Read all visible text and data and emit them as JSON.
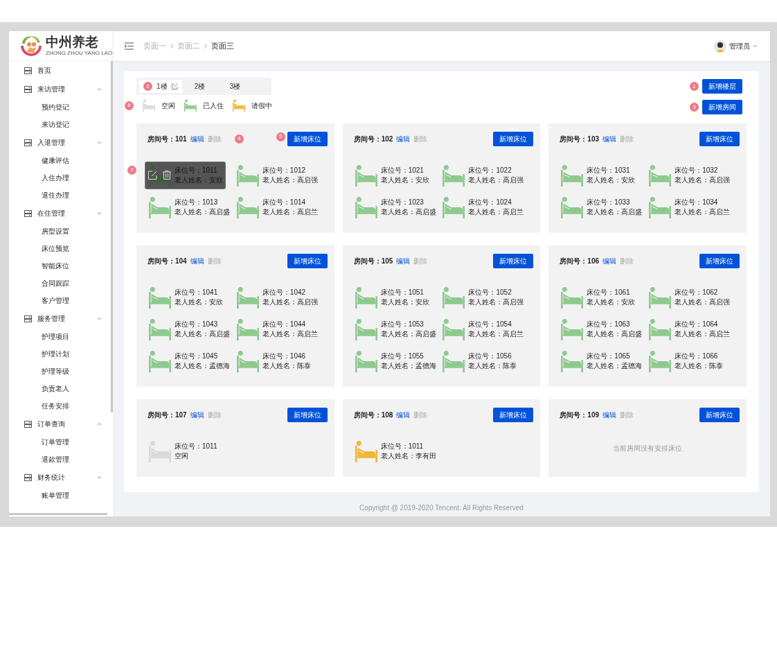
{
  "logo": {
    "title": "中州养老",
    "subtitle": "ZHONG ZHOU YANG LAO"
  },
  "sidebar": {
    "items": [
      {
        "label": "首页"
      },
      {
        "label": "来访管理",
        "expanded": true,
        "children": [
          {
            "label": "预约登记"
          },
          {
            "label": "来访登记"
          }
        ]
      },
      {
        "label": "入退管理",
        "expanded": true,
        "children": [
          {
            "label": "健康评估"
          },
          {
            "label": "入住办理"
          },
          {
            "label": "退住办理"
          }
        ]
      },
      {
        "label": "在住管理",
        "expanded": true,
        "children": [
          {
            "label": "房型设置"
          },
          {
            "label": "床位预览"
          },
          {
            "label": "智能床位"
          },
          {
            "label": "合同跟踪"
          },
          {
            "label": "客户管理"
          }
        ]
      },
      {
        "label": "服务管理",
        "expanded": true,
        "children": [
          {
            "label": "护理项目"
          },
          {
            "label": "护理计划"
          },
          {
            "label": "护理等级"
          },
          {
            "label": "负责老人"
          },
          {
            "label": "任务安排"
          }
        ]
      },
      {
        "label": "订单查询",
        "expanded": true,
        "children": [
          {
            "label": "订单管理"
          },
          {
            "label": "退款管理"
          }
        ]
      },
      {
        "label": "财务统计",
        "expanded": true,
        "children": [
          {
            "label": "账单管理"
          }
        ]
      }
    ]
  },
  "breadcrumb": [
    {
      "label": "页面一",
      "current": false
    },
    {
      "label": "页面二",
      "current": false
    },
    {
      "label": "页面三",
      "current": true
    }
  ],
  "user": {
    "name": "管理员"
  },
  "floor_tabs": [
    {
      "label": "1楼",
      "selected": true,
      "badge": "2"
    },
    {
      "label": "2楼",
      "selected": false
    },
    {
      "label": "3楼",
      "selected": false
    }
  ],
  "legend": {
    "badge": "8",
    "items": [
      {
        "label": "空闲",
        "kind": "free"
      },
      {
        "label": "已入住",
        "kind": "occupied"
      },
      {
        "label": "请假中",
        "kind": "leave"
      }
    ]
  },
  "actions": [
    {
      "label": "新增楼层",
      "badge": "1"
    },
    {
      "label": "新增房间",
      "badge": "3"
    }
  ],
  "rooms": [
    {
      "title": "房间号：101",
      "edit": "编辑",
      "delete": "删除",
      "delete_disabled": true,
      "badge": "4",
      "add_bed": "新增床位",
      "add_bed_badge": "5",
      "hover_badge": "7",
      "beds": [
        {
          "number": "床位号：1011",
          "person": "老人姓名：安欣",
          "kind": "occupied",
          "hovered": true
        },
        {
          "number": "床位号：1012",
          "person": "老人姓名：高启强",
          "kind": "occupied",
          "hovered": false
        },
        {
          "number": "床位号：1013",
          "person": "老人姓名：高启盛",
          "kind": "occupied",
          "hovered": false
        },
        {
          "number": "床位号：1014",
          "person": "老人姓名：高启兰",
          "kind": "occupied",
          "hovered": false
        }
      ]
    },
    {
      "title": "房间号：102",
      "edit": "编辑",
      "delete": "删除",
      "delete_disabled": true,
      "add_bed": "新增床位",
      "beds": [
        {
          "number": "床位号：1021",
          "person": "老人姓名：安欣",
          "kind": "occupied",
          "hovered": false
        },
        {
          "number": "床位号：1022",
          "person": "老人姓名：高启强",
          "kind": "occupied",
          "hovered": false
        },
        {
          "number": "床位号：1023",
          "person": "老人姓名：高启盛",
          "kind": "occupied",
          "hovered": false
        },
        {
          "number": "床位号：1024",
          "person": "老人姓名：高启兰",
          "kind": "occupied",
          "hovered": false
        }
      ]
    },
    {
      "title": "房间号：103",
      "edit": "编辑",
      "delete": "删除",
      "delete_disabled": true,
      "add_bed": "新增床位",
      "beds": [
        {
          "number": "床位号：1031",
          "person": "老人姓名：安欣",
          "kind": "occupied",
          "hovered": false
        },
        {
          "number": "床位号：1032",
          "person": "老人姓名：高启强",
          "kind": "occupied",
          "hovered": false
        },
        {
          "number": "床位号：1033",
          "person": "老人姓名：高启盛",
          "kind": "occupied",
          "hovered": false
        },
        {
          "number": "床位号：1034",
          "person": "老人姓名：高启兰",
          "kind": "occupied",
          "hovered": false
        }
      ]
    },
    {
      "title": "房间号：104",
      "edit": "编辑",
      "delete": "删除",
      "delete_disabled": true,
      "add_bed": "新增床位",
      "beds": [
        {
          "number": "床位号：1041",
          "person": "老人姓名：安欣",
          "kind": "occupied",
          "hovered": false
        },
        {
          "number": "床位号：1042",
          "person": "老人姓名：高启强",
          "kind": "occupied",
          "hovered": false
        },
        {
          "number": "床位号：1043",
          "person": "老人姓名：高启盛",
          "kind": "occupied",
          "hovered": false
        },
        {
          "number": "床位号：1044",
          "person": "老人姓名：高启兰",
          "kind": "occupied",
          "hovered": false
        },
        {
          "number": "床位号：1045",
          "person": "老人姓名：孟德海",
          "kind": "occupied",
          "hovered": false
        },
        {
          "number": "床位号：1046",
          "person": "老人姓名：陈泰",
          "kind": "occupied",
          "hovered": false
        }
      ]
    },
    {
      "title": "房间号：105",
      "edit": "编辑",
      "delete": "删除",
      "delete_disabled": true,
      "add_bed": "新增床位",
      "beds": [
        {
          "number": "床位号：1051",
          "person": "老人姓名：安欣",
          "kind": "occupied",
          "hovered": false
        },
        {
          "number": "床位号：1052",
          "person": "老人姓名：高启强",
          "kind": "occupied",
          "hovered": false
        },
        {
          "number": "床位号：1053",
          "person": "老人姓名：高启盛",
          "kind": "occupied",
          "hovered": false
        },
        {
          "number": "床位号：1054",
          "person": "老人姓名：高启兰",
          "kind": "occupied",
          "hovered": false
        },
        {
          "number": "床位号：1055",
          "person": "老人姓名：孟德海",
          "kind": "occupied",
          "hovered": false
        },
        {
          "number": "床位号：1056",
          "person": "老人姓名：陈泰",
          "kind": "occupied",
          "hovered": false
        }
      ]
    },
    {
      "title": "房间号：106",
      "edit": "编辑",
      "delete": "删除",
      "delete_disabled": true,
      "add_bed": "新增床位",
      "beds": [
        {
          "number": "床位号：1061",
          "person": "老人姓名：安欣",
          "kind": "occupied",
          "hovered": false
        },
        {
          "number": "床位号：1062",
          "person": "老人姓名：高启强",
          "kind": "occupied",
          "hovered": false
        },
        {
          "number": "床位号：1063",
          "person": "老人姓名：高启盛",
          "kind": "occupied",
          "hovered": false
        },
        {
          "number": "床位号：1064",
          "person": "老人姓名：高启兰",
          "kind": "occupied",
          "hovered": false
        },
        {
          "number": "床位号：1065",
          "person": "老人姓名：孟德海",
          "kind": "occupied",
          "hovered": false
        },
        {
          "number": "床位号：1066",
          "person": "老人姓名：陈泰",
          "kind": "occupied",
          "hovered": false
        }
      ]
    },
    {
      "title": "房间号：107",
      "edit": "编辑",
      "delete": "删除",
      "delete_disabled": true,
      "add_bed": "新增床位",
      "beds": [
        {
          "number": "床位号：1011",
          "person": "空闲",
          "kind": "free",
          "hovered": false
        }
      ]
    },
    {
      "title": "房间号：108",
      "edit": "编辑",
      "delete": "删除",
      "delete_disabled": true,
      "add_bed": "新增床位",
      "beds": [
        {
          "number": "床位号：1011",
          "person": "老人姓名：李有田",
          "kind": "leave",
          "hovered": false
        }
      ]
    },
    {
      "title": "房间号：109",
      "edit": "编辑",
      "delete": "删除",
      "delete_disabled": true,
      "add_bed": "新增床位",
      "empty_text": "当前房间没有安排床位"
    }
  ],
  "footer": "Copyright @ 2019-2020 Tencent. All Rights Reserved"
}
